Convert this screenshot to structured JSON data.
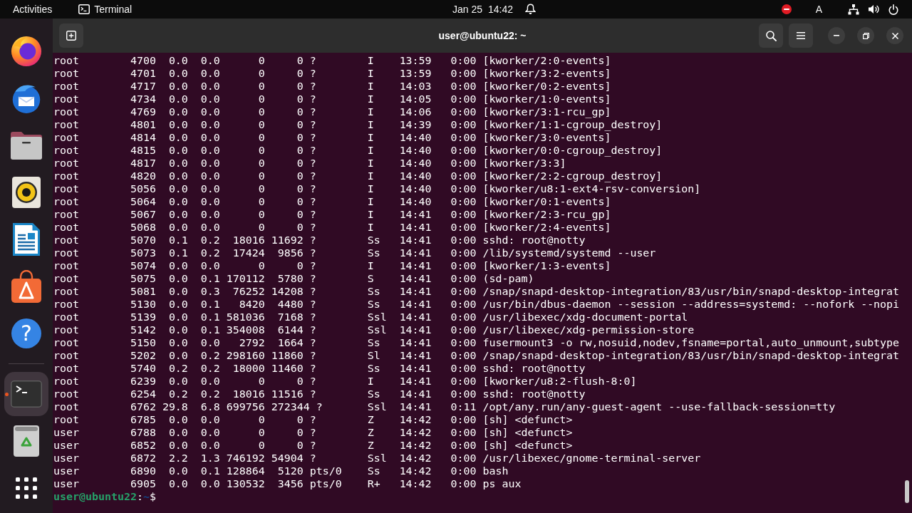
{
  "top_bar": {
    "activities": "Activities",
    "app_menu": "Terminal",
    "date": "Jan 25",
    "time": "14:42",
    "input_source": "A"
  },
  "dock": {
    "pinned": [
      {
        "kind": "browser",
        "running": false,
        "selected": false
      },
      {
        "kind": "mail",
        "running": false,
        "selected": false
      },
      {
        "kind": "files",
        "running": false,
        "selected": false
      },
      {
        "kind": "music",
        "running": false,
        "selected": false
      },
      {
        "kind": "writer",
        "running": false,
        "selected": false
      },
      {
        "kind": "store",
        "running": false,
        "selected": false
      },
      {
        "kind": "help",
        "glyph": "?",
        "running": false,
        "selected": false
      }
    ],
    "others": [
      {
        "kind": "terminal",
        "running": true,
        "selected": true
      },
      {
        "kind": "trash",
        "running": false,
        "selected": false
      }
    ]
  },
  "terminal": {
    "title": "user@ubuntu22: ~",
    "lines": [
      "root        4700  0.0  0.0      0     0 ?        I    13:59   0:00 [kworker/2:0-events]",
      "root        4701  0.0  0.0      0     0 ?        I    13:59   0:00 [kworker/3:2-events]",
      "root        4717  0.0  0.0      0     0 ?        I    14:03   0:00 [kworker/0:2-events]",
      "root        4734  0.0  0.0      0     0 ?        I    14:05   0:00 [kworker/1:0-events]",
      "root        4769  0.0  0.0      0     0 ?        I    14:06   0:00 [kworker/3:1-rcu_gp]",
      "root        4801  0.0  0.0      0     0 ?        I    14:39   0:00 [kworker/1:1-cgroup_destroy]",
      "root        4814  0.0  0.0      0     0 ?        I    14:40   0:00 [kworker/3:0-events]",
      "root        4815  0.0  0.0      0     0 ?        I    14:40   0:00 [kworker/0:0-cgroup_destroy]",
      "root        4817  0.0  0.0      0     0 ?        I    14:40   0:00 [kworker/3:3]",
      "root        4820  0.0  0.0      0     0 ?        I    14:40   0:00 [kworker/2:2-cgroup_destroy]",
      "root        5056  0.0  0.0      0     0 ?        I    14:40   0:00 [kworker/u8:1-ext4-rsv-conversion]",
      "root        5064  0.0  0.0      0     0 ?        I    14:40   0:00 [kworker/0:1-events]",
      "root        5067  0.0  0.0      0     0 ?        I    14:41   0:00 [kworker/2:3-rcu_gp]",
      "root        5068  0.0  0.0      0     0 ?        I    14:41   0:00 [kworker/2:4-events]",
      "root        5070  0.1  0.2  18016 11692 ?        Ss   14:41   0:00 sshd: root@notty",
      "root        5073  0.1  0.2  17424  9856 ?        Ss   14:41   0:00 /lib/systemd/systemd --user",
      "root        5074  0.0  0.0      0     0 ?        I    14:41   0:00 [kworker/1:3-events]",
      "root        5075  0.0  0.1 170112  5780 ?        S    14:41   0:00 (sd-pam)",
      "root        5081  0.0  0.3  76252 14208 ?        Ss   14:41   0:00 /snap/snapd-desktop-integration/83/usr/bin/snapd-desktop-integrat",
      "root        5130  0.0  0.1   8420  4480 ?        Ss   14:41   0:00 /usr/bin/dbus-daemon --session --address=systemd: --nofork --nopi",
      "root        5139  0.0  0.1 581036  7168 ?        Ssl  14:41   0:00 /usr/libexec/xdg-document-portal",
      "root        5142  0.0  0.1 354008  6144 ?        Ssl  14:41   0:00 /usr/libexec/xdg-permission-store",
      "root        5150  0.0  0.0   2792  1664 ?        Ss   14:41   0:00 fusermount3 -o rw,nosuid,nodev,fsname=portal,auto_unmount,subtype",
      "root        5202  0.0  0.2 298160 11860 ?        Sl   14:41   0:00 /snap/snapd-desktop-integration/83/usr/bin/snapd-desktop-integrat",
      "root        5740  0.2  0.2  18000 11460 ?        Ss   14:41   0:00 sshd: root@notty",
      "root        6239  0.0  0.0      0     0 ?        I    14:41   0:00 [kworker/u8:2-flush-8:0]",
      "root        6254  0.2  0.2  18016 11516 ?        Ss   14:41   0:00 sshd: root@notty",
      "root        6762 29.8  6.8 699756 272344 ?       Ssl  14:41   0:11 /opt/any.run/any-guest-agent --use-fallback-session=tty",
      "root        6785  0.0  0.0      0     0 ?        Z    14:42   0:00 [sh] <defunct>",
      "user        6788  0.0  0.0      0     0 ?        Z    14:42   0:00 [sh] <defunct>",
      "user        6852  0.0  0.0      0     0 ?        Z    14:42   0:00 [sh] <defunct>",
      "user        6872  2.2  1.3 746192 54904 ?        Ssl  14:42   0:00 /usr/libexec/gnome-terminal-server",
      "user        6890  0.0  0.1 128864  5120 pts/0    Ss   14:42   0:00 bash",
      "user        6905  0.0  0.0 130532  3456 pts/0    R+   14:42   0:00 ps aux"
    ],
    "prompt": [
      {
        "kind": "user",
        "text": "user@ubuntu22"
      },
      {
        "kind": "plain",
        "text": ":"
      },
      {
        "kind": "path",
        "text": "~"
      },
      {
        "kind": "plain",
        "text": "$"
      }
    ]
  }
}
